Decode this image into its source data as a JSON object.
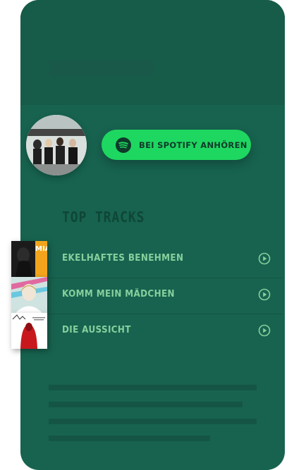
{
  "colors": {
    "card_background": "#17634f",
    "header_background": "#175c49",
    "spotify_green": "#1ed760",
    "track_text": "#87cf9d",
    "section_title": "#0f4636"
  },
  "artist": {
    "avatar_icon": "band-photo-avatar"
  },
  "spotify_button": {
    "label": "BEI SPOTIFY ANHÖREN",
    "icon": "spotify-icon"
  },
  "top_tracks": {
    "title": "TOP TRACKS",
    "tracks": [
      {
        "title": "EKELHAFTES BENEHMEN",
        "cover_text": "MIA.",
        "play_icon": "play-circle-icon"
      },
      {
        "title": "KOMM MEIN MÄDCHEN",
        "play_icon": "play-circle-icon"
      },
      {
        "title": "DIE AUSSICHT",
        "play_icon": "play-circle-icon"
      }
    ]
  }
}
